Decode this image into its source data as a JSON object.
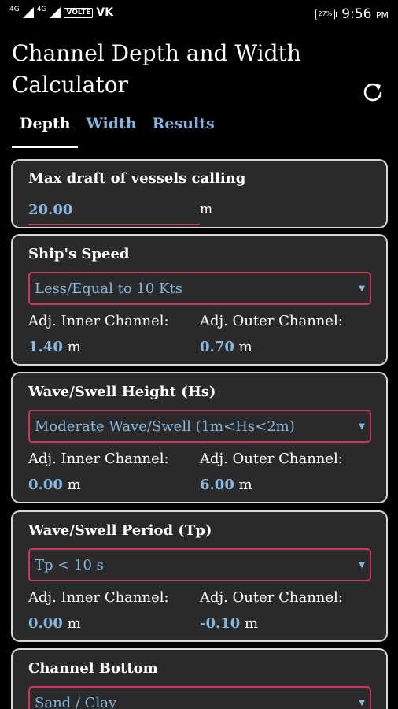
{
  "status_bar": {
    "network_1": "4G",
    "network_2": "4G",
    "volte": "VOLTE",
    "carrier": "VK",
    "battery": "27%",
    "time": "9:56",
    "ampm": "PM"
  },
  "app": {
    "title": "Channel Depth and Width Calculator",
    "refresh_icon": "refresh-icon"
  },
  "tabs": [
    {
      "label": "Depth",
      "active": true
    },
    {
      "label": "Width",
      "active": false
    },
    {
      "label": "Results",
      "active": false
    }
  ],
  "draft": {
    "label": "Max draft of vessels calling",
    "value": "20.00",
    "unit": "m"
  },
  "ship_speed": {
    "label": "Ship's Speed",
    "selected": "Less/Equal to 10 Kts",
    "inner_label": "Adj. Inner Channel:",
    "inner_value": "1.40",
    "outer_label": "Adj. Outer Channel:",
    "outer_value": "0.70",
    "unit": "m"
  },
  "wave_height": {
    "label": "Wave/Swell Height (Hs)",
    "selected": "Moderate Wave/Swell (1m<Hs<2m)",
    "inner_label": "Adj. Inner Channel:",
    "inner_value": "0.00",
    "outer_label": "Adj. Outer Channel:",
    "outer_value": "6.00",
    "unit": "m"
  },
  "wave_period": {
    "label": "Wave/Swell Period (Tp)",
    "selected": "Tp < 10 s",
    "inner_label": "Adj. Inner Channel:",
    "inner_value": "0.00",
    "outer_label": "Adj. Outer Channel:",
    "outer_value": "-0.10",
    "unit": "m"
  },
  "channel_bottom": {
    "label": "Channel Bottom",
    "selected": "Sand / Clay"
  },
  "colors": {
    "accent_blue": "#87b8e0",
    "border_red": "#c93a5a",
    "card_bg": "#2a2a2a"
  }
}
